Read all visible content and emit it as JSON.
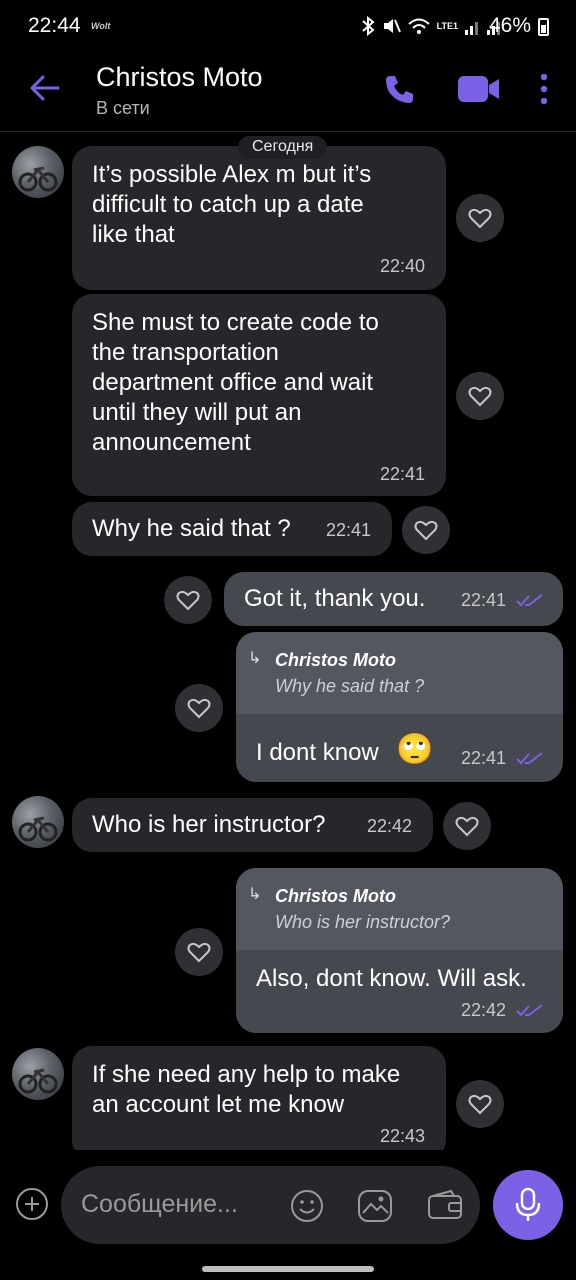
{
  "status_bar": {
    "time": "22:44",
    "app_label": "Wolt",
    "battery": "46%",
    "network_label": "LTE1"
  },
  "header": {
    "contact_name": "Christos Moto",
    "contact_status": "В сети"
  },
  "chat": {
    "date_divider": "Сегодня",
    "messages": [
      {
        "direction": "in",
        "text_lines": [
          "It’s possible Alex m but it’s",
          "difficult to catch up a date",
          "like that"
        ],
        "time": "22:40"
      },
      {
        "direction": "in",
        "text_lines": [
          "She must to create code to",
          "the transportation",
          "department office and wait",
          "until they will put an",
          "announcement"
        ],
        "time": "22:41"
      },
      {
        "direction": "in",
        "text_lines": [
          "Why he said that ?"
        ],
        "time": "22:41"
      },
      {
        "direction": "out",
        "text_lines": [
          "Got it, thank you."
        ],
        "time": "22:41",
        "read": true
      },
      {
        "direction": "out",
        "reply_to_name": "Christos Moto",
        "reply_to_text": "Why he said that ?",
        "text_lines": [
          "I dont know"
        ],
        "emoji": "🙄",
        "time": "22:41",
        "read": true
      },
      {
        "direction": "in",
        "text_lines": [
          "Who is her instructor?"
        ],
        "time": "22:42"
      },
      {
        "direction": "out",
        "reply_to_name": "Christos Moto",
        "reply_to_text": "Who is her instructor?",
        "text_lines": [
          "Also, dont know. Will ask."
        ],
        "time": "22:42",
        "read": true
      },
      {
        "direction": "in",
        "text_lines": [
          "If she need any help to make",
          "an account let me know"
        ],
        "time": "22:43"
      }
    ]
  },
  "composer": {
    "placeholder": "Сообщение..."
  },
  "colors": {
    "accent": "#7c61e6",
    "incoming_bubble": "#26272b",
    "outgoing_bubble": "#45484f",
    "reply_quote": "#545760",
    "background": "#000000"
  },
  "icons": [
    "back-arrow-icon",
    "phone-icon",
    "video-camera-icon",
    "more-vertical-icon",
    "heart-icon",
    "double-check-icon",
    "plus-icon",
    "emoji-icon",
    "sticker-icon",
    "wallet-icon",
    "microphone-icon"
  ]
}
